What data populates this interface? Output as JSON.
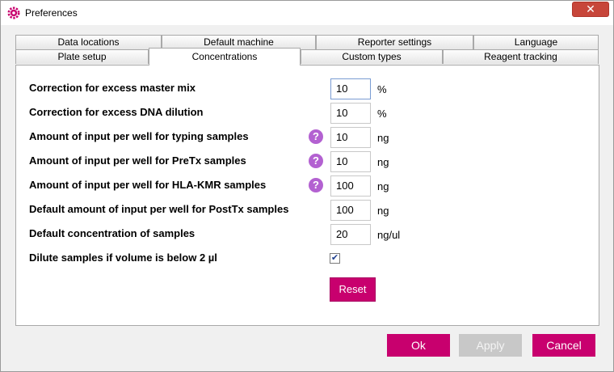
{
  "window": {
    "title": "Preferences",
    "close_symbol": "✕"
  },
  "tabs": {
    "row_back": [
      "Data locations",
      "Default machine",
      "Reporter settings",
      "Language"
    ],
    "row_front": [
      "Plate setup",
      "Concentrations",
      "Custom types",
      "Reagent tracking"
    ],
    "active": "Concentrations"
  },
  "settings": [
    {
      "label": "Correction for excess master mix",
      "value": "10",
      "unit": "%",
      "help": false
    },
    {
      "label": "Correction for excess DNA dilution",
      "value": "10",
      "unit": "%",
      "help": false
    },
    {
      "label": "Amount of input per well for typing samples",
      "value": "10",
      "unit": "ng",
      "help": true
    },
    {
      "label": "Amount of input per well for PreTx samples",
      "value": "10",
      "unit": "ng",
      "help": true
    },
    {
      "label": "Amount of input per well for HLA-KMR samples",
      "value": "100",
      "unit": "ng",
      "help": true
    },
    {
      "label": "Default amount of input per well for PostTx samples",
      "value": "100",
      "unit": "ng",
      "help": false
    },
    {
      "label": "Default concentration of samples",
      "value": "20",
      "unit": "ng/ul",
      "help": false
    }
  ],
  "dilute": {
    "label": "Dilute samples if volume is below 2 µl",
    "checked": true,
    "check_symbol": "✔"
  },
  "help_symbol": "?",
  "buttons": {
    "reset": "Reset",
    "ok": "Ok",
    "apply": "Apply",
    "cancel": "Cancel"
  },
  "colors": {
    "accent": "#c8006e",
    "help": "#b361d1",
    "close": "#c7463a",
    "disabled": "#c8c8c8"
  }
}
